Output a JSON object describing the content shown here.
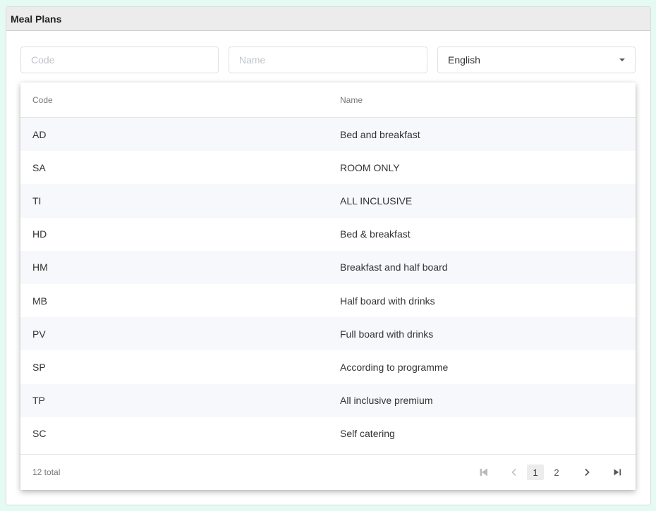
{
  "panel": {
    "title": "Meal Plans"
  },
  "filters": {
    "code_placeholder": "Code",
    "code_value": "",
    "name_placeholder": "Name",
    "name_value": "",
    "language_selected": "English"
  },
  "table": {
    "columns": [
      "Code",
      "Name"
    ],
    "rows": [
      {
        "code": "AD",
        "name": "Bed and breakfast"
      },
      {
        "code": "SA",
        "name": "ROOM ONLY"
      },
      {
        "code": "TI",
        "name": "ALL INCLUSIVE"
      },
      {
        "code": "HD",
        "name": "Bed & breakfast"
      },
      {
        "code": "HM",
        "name": "Breakfast and half board"
      },
      {
        "code": "MB",
        "name": "Half board with drinks"
      },
      {
        "code": "PV",
        "name": "Full board with drinks"
      },
      {
        "code": "SP",
        "name": "According to programme"
      },
      {
        "code": "TP",
        "name": "All inclusive premium"
      },
      {
        "code": "SC",
        "name": "Self catering"
      }
    ]
  },
  "pagination": {
    "total_text": "12 total",
    "pages": [
      "1",
      "2"
    ],
    "current_page": "1",
    "icons": [
      "first-page-icon",
      "prev-page-icon",
      "next-page-icon",
      "last-page-icon"
    ]
  }
}
